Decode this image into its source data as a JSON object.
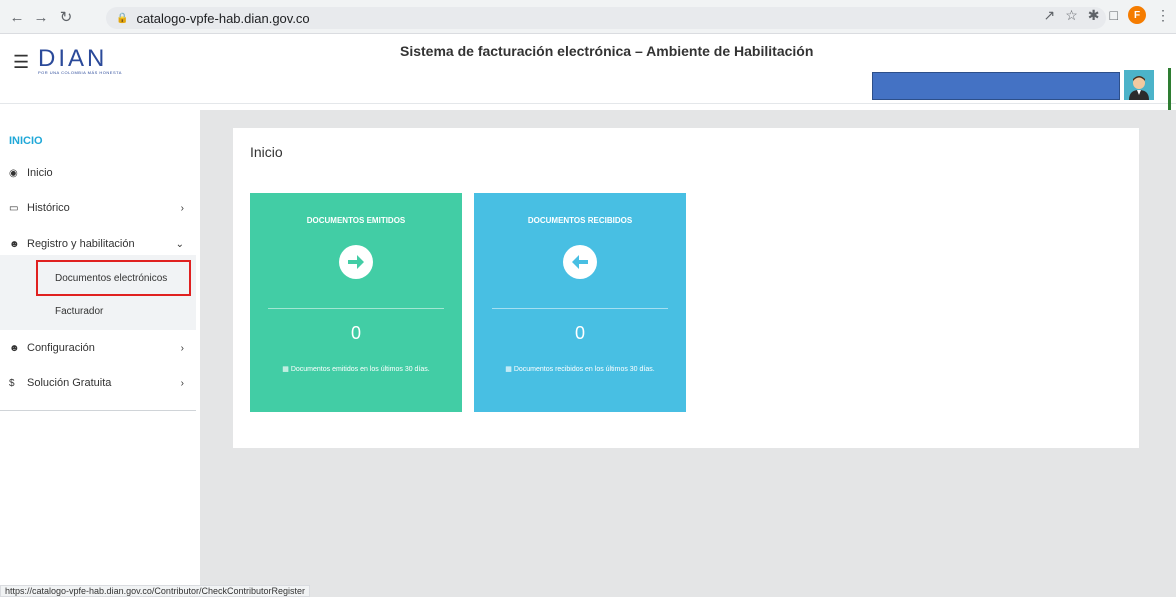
{
  "browser": {
    "url": "catalogo-vpfe-hab.dian.gov.co",
    "profile_initial": "F",
    "status_url": "https://catalogo-vpfe-hab.dian.gov.co/Contributor/CheckContributorRegister"
  },
  "header": {
    "logo_text": "DIAN",
    "logo_tagline": "POR UNA COLOMBIA MÁS HONESTA",
    "title": "Sistema de facturación electrónica – Ambiente de Habilitación"
  },
  "sidebar": {
    "section": "INICIO",
    "items": [
      {
        "label": "Inicio",
        "icon": "dashboard-icon"
      },
      {
        "label": "Histórico",
        "icon": "inbox-icon"
      },
      {
        "label": "Registro y habilitación",
        "icon": "users-icon"
      },
      {
        "label": "Configuración",
        "icon": "users-icon"
      },
      {
        "label": "Solución Gratuita",
        "icon": "dollar-icon"
      }
    ],
    "subitems": [
      {
        "label": "Documentos electrónicos"
      },
      {
        "label": "Facturador"
      }
    ]
  },
  "main": {
    "title": "Inicio",
    "tiles": [
      {
        "title": "DOCUMENTOS EMITIDOS",
        "count": "0",
        "description": "Documentos emitidos en los últimos 30 días.",
        "color": "#42cda5"
      },
      {
        "title": "DOCUMENTOS RECIBIDOS",
        "count": "0",
        "description": "Documentos recibidos en los últimos 30 días.",
        "color": "#48bfe3"
      }
    ]
  },
  "colors": {
    "accent": "#20a8d8",
    "highlight": "#e02020",
    "user_box": "#4472c4"
  }
}
